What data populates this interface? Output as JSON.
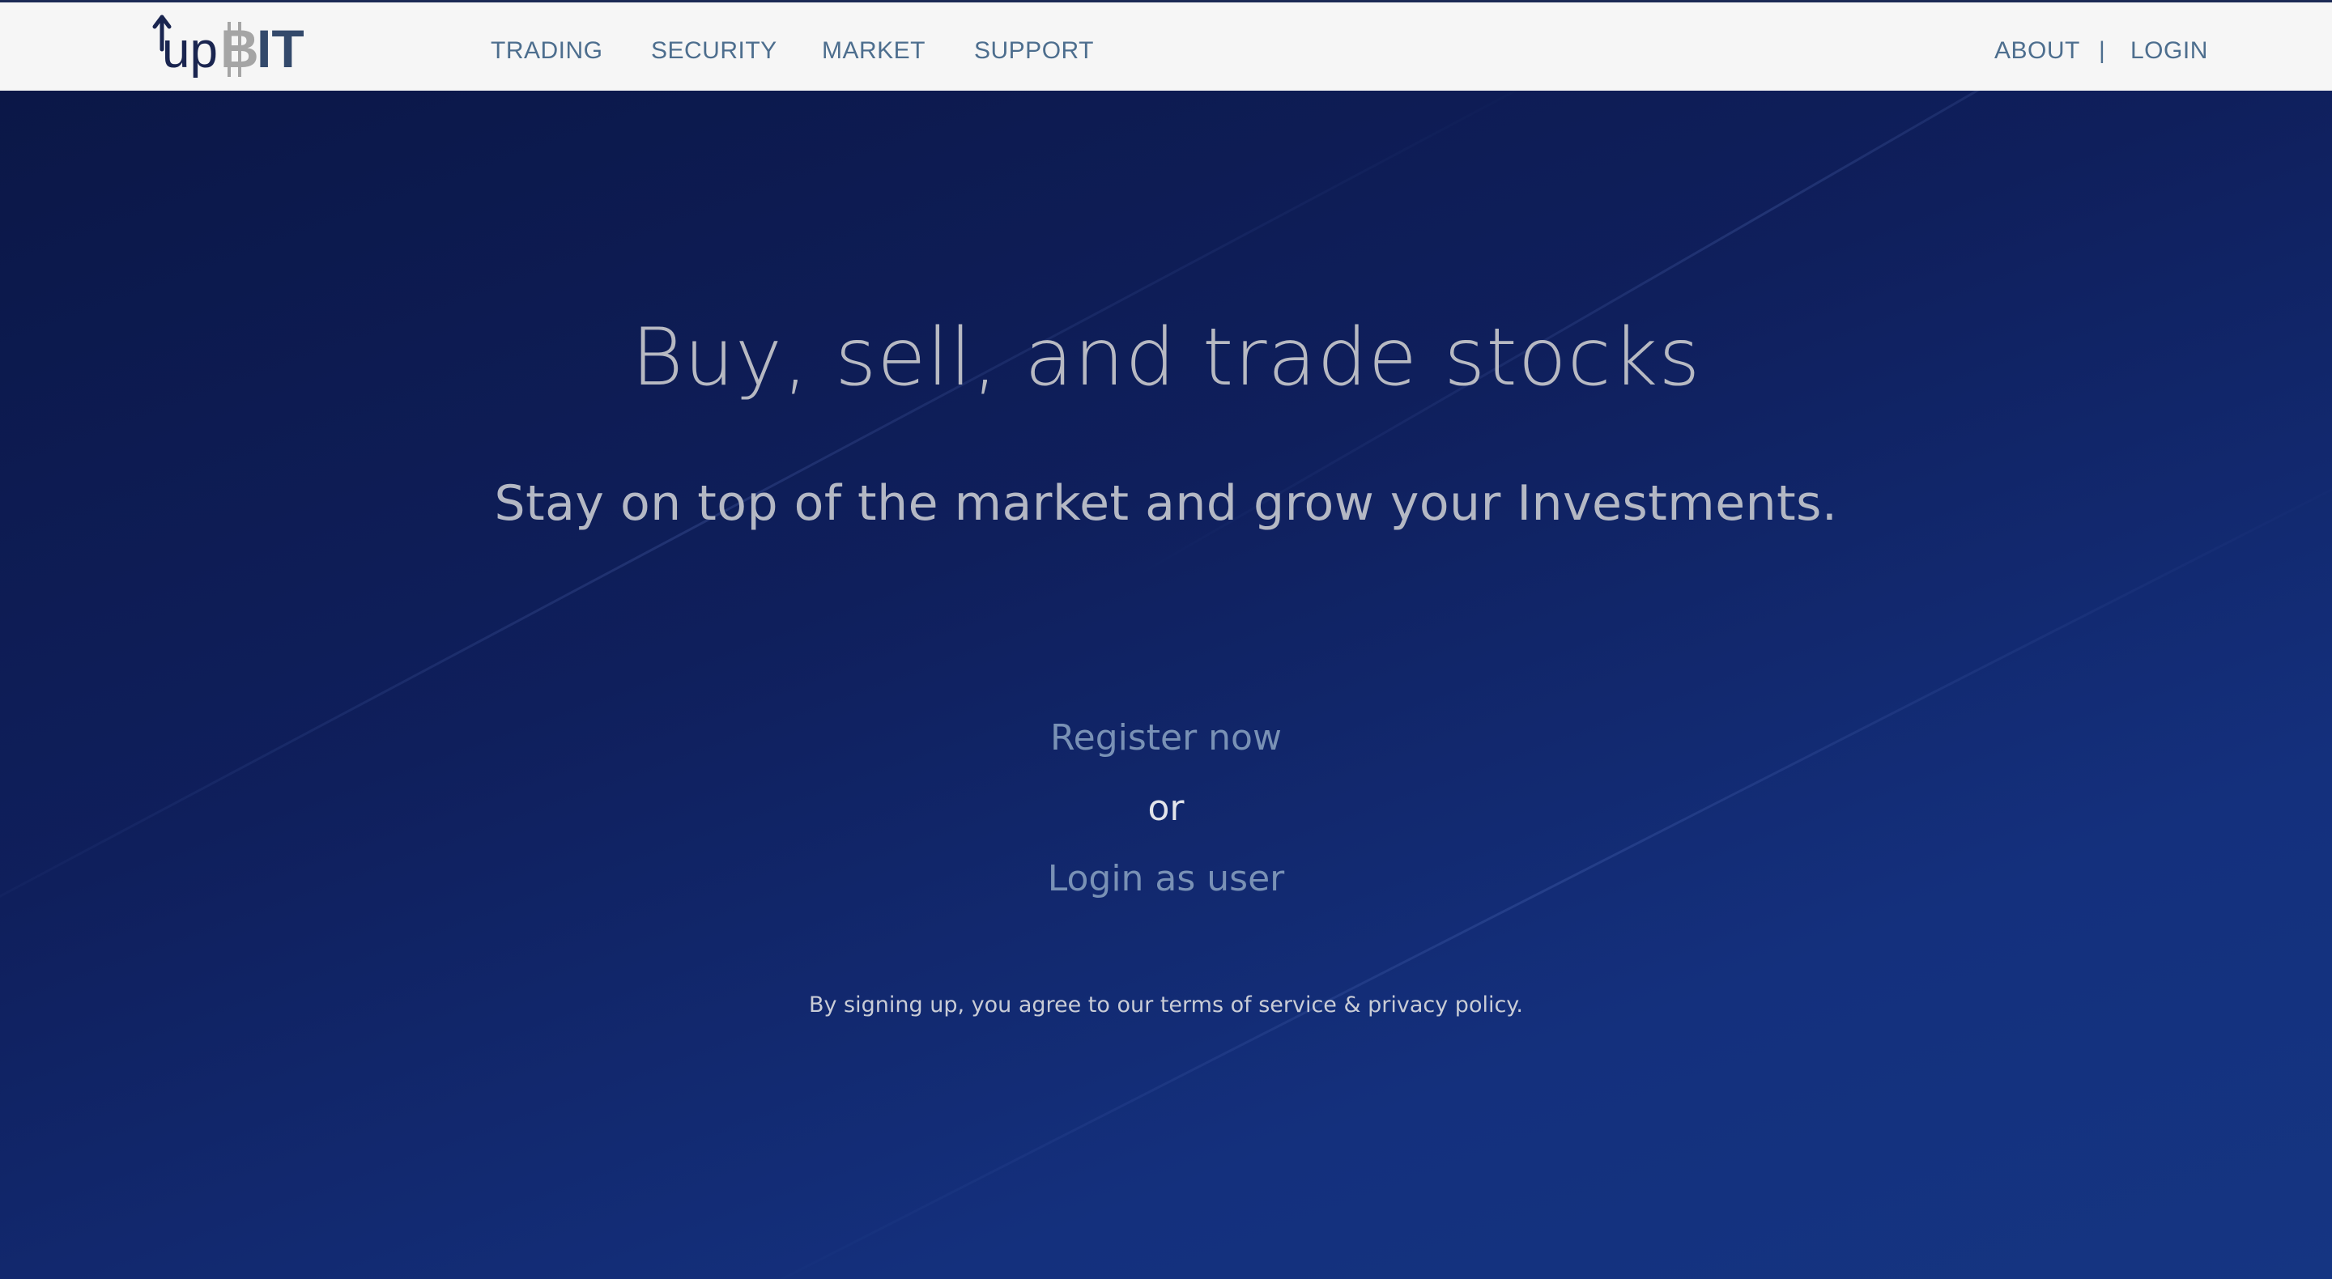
{
  "brand": {
    "logo_text_up": "up",
    "logo_text_bit": "BIT",
    "colors": {
      "navy": "#1a2550",
      "grey": "#a5a5a5",
      "slate": "#33496b"
    }
  },
  "nav": {
    "left_items": [
      "TRADING",
      "SECURITY",
      "MARKET",
      "SUPPORT"
    ],
    "about": "ABOUT",
    "separator": "|",
    "login": "LOGIN"
  },
  "hero": {
    "headline": "Buy, sell, and trade stocks",
    "subheadline": "Stay on top of the market and grow your Investments.",
    "register": "Register now",
    "or": "or",
    "login_user": "Login as user",
    "terms": "By signing up, you agree to our terms of service & privacy policy."
  },
  "colors": {
    "nav_bg": "#f6f6f6",
    "nav_text": "#4d6e8e",
    "hero_bg_start": "#0b1747",
    "hero_bg_end": "#153582",
    "link": "#7991b5"
  }
}
